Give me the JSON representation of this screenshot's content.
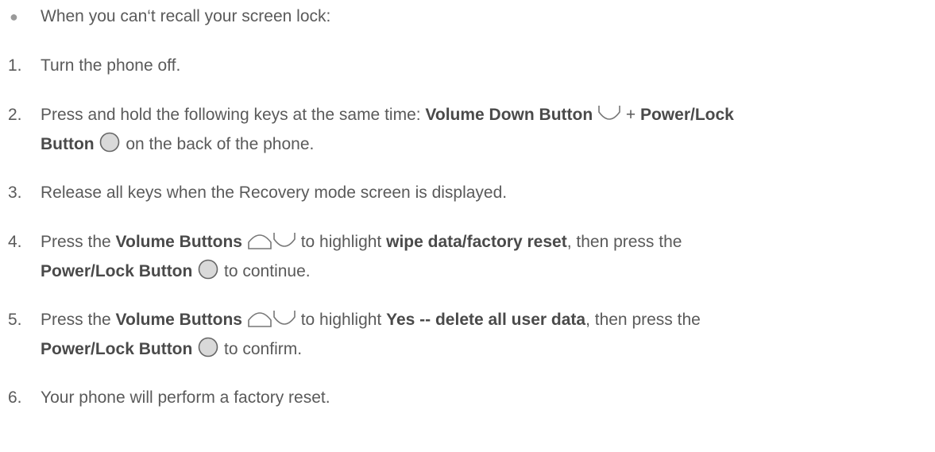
{
  "intro": {
    "bullet": "●",
    "text": "When you can‘t recall your screen lock:"
  },
  "steps": [
    {
      "num": "1.",
      "text": "Turn the phone off."
    },
    {
      "num": "2.",
      "a": "Press and hold the following keys at the same time: ",
      "b1": "Volume Down Button",
      "c": "+ ",
      "b2": "Power/Lock",
      "b3": "Button",
      "d": "on the back of the phone."
    },
    {
      "num": "3.",
      "text": "Release all keys when the Recovery mode screen is displayed."
    },
    {
      "num": "4.",
      "a": "Press the ",
      "b1": "Volume Buttons",
      "c": "to highlight ",
      "b2": "wipe data/factory reset",
      "d": ", then press the",
      "b3": "Power/Lock Button",
      "e": "to continue."
    },
    {
      "num": "5.",
      "a": "Press the ",
      "b1": "Volume Buttons",
      "c": "to highlight ",
      "b2": "Yes -- delete all user data",
      "d": ", then press the",
      "b3": "Power/Lock Button",
      "e": "to confirm."
    },
    {
      "num": "6.",
      "text": "Your phone will perform a factory reset."
    }
  ],
  "icons": {
    "volume_up": "volume-up-key-icon",
    "volume_down": "volume-down-key-icon",
    "power": "power-lock-key-icon"
  }
}
